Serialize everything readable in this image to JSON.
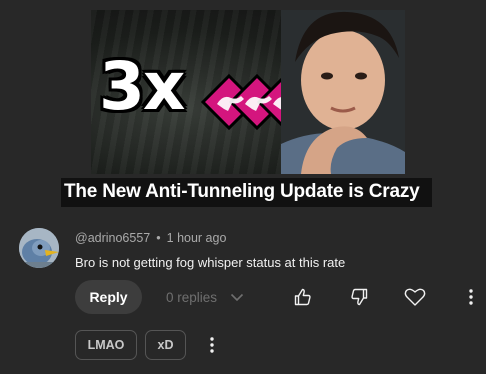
{
  "video": {
    "thumbnail_text": "3x",
    "title": "The New Anti-Tunneling Update is Crazy"
  },
  "comment": {
    "author": "@adrino6557",
    "separator": "•",
    "time": "1 hour ago",
    "text": "Bro is not getting fog whisper status at this rate",
    "reply_label": "Reply",
    "replies_label": "0 replies"
  },
  "icons": {
    "expand": "chevron-down-icon",
    "like": "thumbs-up-icon",
    "dislike": "thumbs-down-icon",
    "heart": "heart-icon",
    "more": "more-vert-icon"
  },
  "suggestions": [
    {
      "label": "LMAO"
    },
    {
      "label": "xD"
    }
  ],
  "colors": {
    "background": "#282828",
    "perk_magenta": "#d4157e",
    "text_secondary": "#aaaaaa"
  }
}
